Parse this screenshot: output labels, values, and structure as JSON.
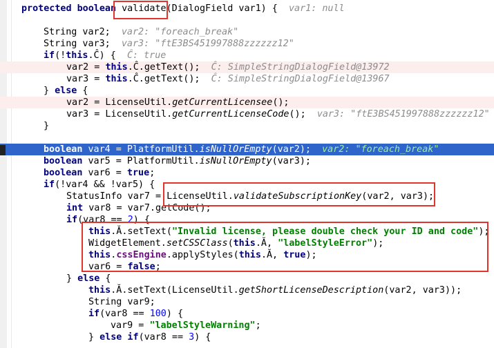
{
  "code": {
    "l1_a": "protected boolean ",
    "l1_b": "validate",
    "l1_c": "(DialogField var1) {  ",
    "l1_hint": "var1: null",
    "l2_a": "String var2;  ",
    "l2_hint": "var2: \"foreach_break\"",
    "l3_a": "String var3;  ",
    "l3_hint": "var3: \"ftE3BS451997888zzzzzz12\"",
    "l4_a": "if",
    "l4_b": "(!",
    "l4_c": "this",
    "l4_d": ".Ĉ) {  ",
    "l4_hint": "Ĉ: true",
    "l5_a": "var2 = ",
    "l5_b": "this",
    "l5_c": ".Ĉ.getText();  ",
    "l5_hint": "Ĉ: SimpleStringDialogField@13972",
    "l6_a": "var3 = ",
    "l6_b": "this",
    "l6_c": ".Ĉ.getText();  ",
    "l6_hint": "Ĉ: SimpleStringDialogField@13967",
    "l7_a": "} ",
    "l7_b": "else",
    "l7_c": " {",
    "l8_a": "var2 = LicenseUtil.",
    "l8_b": "getCurrentLicensee",
    "l8_c": "();",
    "l9_a": "var3 = LicenseUtil.",
    "l9_b": "getCurrentLicenseCode",
    "l9_c": "();  ",
    "l9_hint": "var3: \"ftE3BS451997888zzzzzz12\"",
    "l10": "}",
    "l11_a": "boolean",
    "l11_b": " var4 = PlatformUtil.",
    "l11_c": "isNullOrEmpty",
    "l11_d": "(var2);  ",
    "l11_hint": "var2: \"foreach_break\"",
    "l12_a": "boolean",
    "l12_b": " var5 = PlatformUtil.",
    "l12_c": "isNullOrEmpty",
    "l12_d": "(var3);",
    "l13_a": "boolean",
    "l13_b": " var6 = ",
    "l13_c": "true",
    "l13_d": ";",
    "l14_a": "if",
    "l14_b": "(!var4 && !var5) {",
    "l15_a": "StatusInfo var7 = LicenseUtil.",
    "l15_b": "validateSubscriptionKey",
    "l15_c": "(var2, var3);",
    "l16_a": "int",
    "l16_b": " var8 = var7.getCode();",
    "l17_a": "if",
    "l17_b": "(var8 == ",
    "l17_c": "2",
    "l17_d": ") {",
    "l18_a": "this",
    "l18_b": ".Ă.setText(",
    "l18_c": "\"Invalid license, please double check your ID and code\"",
    "l18_d": ");",
    "l19_a": "WidgetElement.",
    "l19_b": "setCSSClass",
    "l19_c": "(",
    "l19_d": "this",
    "l19_e": ".Ă, ",
    "l19_f": "\"labelStyleError\"",
    "l19_g": ");",
    "l20_a": "this",
    "l20_b": ".",
    "l20_c": "cssEngine",
    "l20_d": ".applyStyles(",
    "l20_e": "this",
    "l20_f": ".Ă, ",
    "l20_g": "true",
    "l20_h": ");",
    "l21_a": "var6 = ",
    "l21_b": "false",
    "l21_c": ";",
    "l22_a": "} ",
    "l22_b": "else",
    "l22_c": " {",
    "l23_a": "this",
    "l23_b": ".Ă.setText(LicenseUtil.",
    "l23_c": "getShortLicenseDescription",
    "l23_d": "(var2, var3));",
    "l24": "String var9;",
    "l25_a": "if",
    "l25_b": "(var8 == ",
    "l25_c": "100",
    "l25_d": ") {",
    "l26_a": "var9 = ",
    "l26_b": "\"labelStyleWarning\"",
    "l26_c": ";",
    "l27_a": "} ",
    "l27_b": "else if",
    "l27_c": "(var8 == ",
    "l27_d": "3",
    "l27_e": ") {"
  }
}
